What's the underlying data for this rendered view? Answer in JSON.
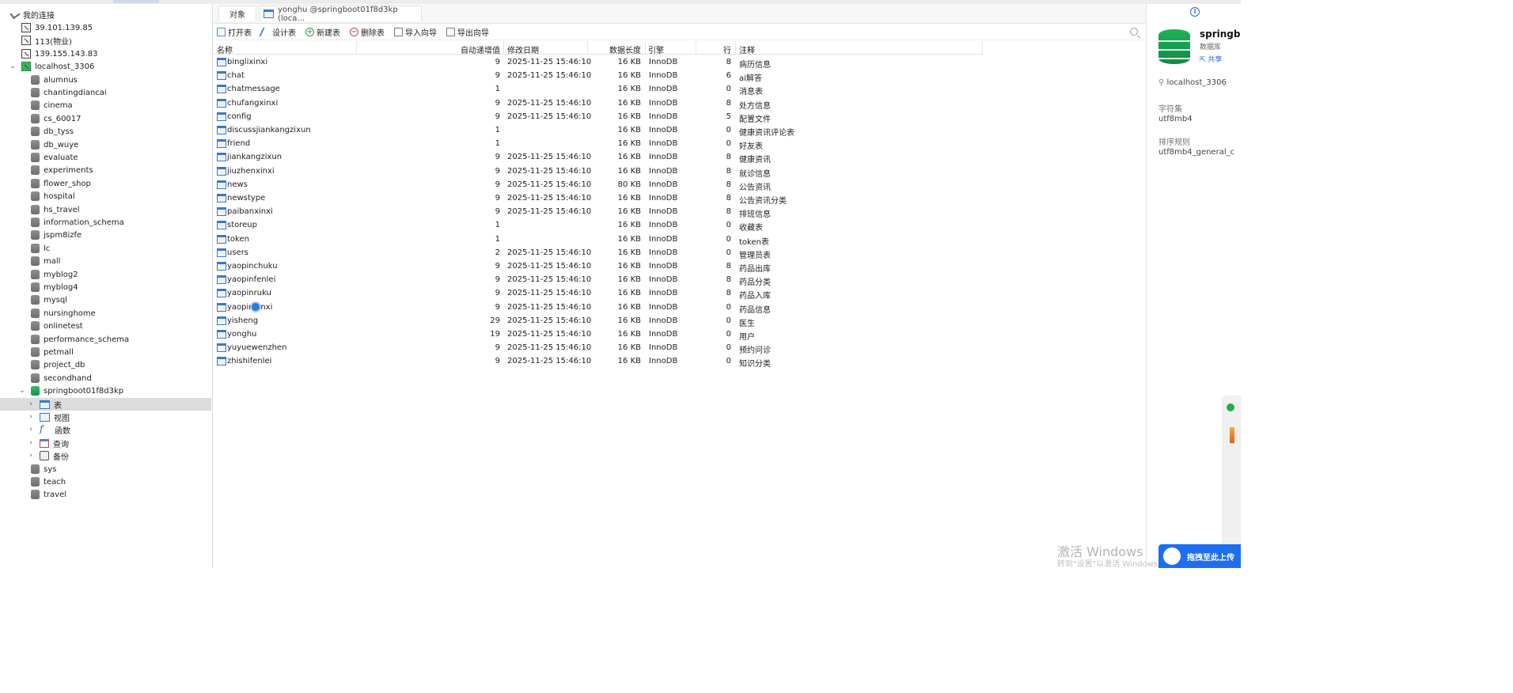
{
  "sidebar": {
    "root_label": "我的连接",
    "connections": [
      "39.101.139.85",
      "113(物业)",
      "139.155.143.83",
      "localhost_3306"
    ],
    "databases": [
      "alumnus",
      "chantingdiancai",
      "cinema",
      "cs_60017",
      "db_tyss",
      "db_wuye",
      "evaluate",
      "experiments",
      "flower_shop",
      "hospital",
      "hs_travel",
      "information_schema",
      "jspm8izfe",
      "lc",
      "mall",
      "myblog2",
      "myblog4",
      "mysql",
      "nursinghome",
      "onlinetest",
      "performance_schema",
      "petmall",
      "project_db",
      "secondhand",
      "springboot01f8d3kp"
    ],
    "sub_nodes": [
      "表",
      "视图",
      "函数",
      "查询",
      "备份"
    ],
    "databases_after": [
      "sys",
      "teach",
      "travel"
    ]
  },
  "tabs": {
    "objects": "对象",
    "table_tab": "yonghu @springboot01f8d3kp (loca..."
  },
  "toolbar": {
    "open": "打开表",
    "design": "设计表",
    "new": "新建表",
    "delete": "删除表",
    "import": "导入向导",
    "export": "导出向导"
  },
  "columns": {
    "name": "名称",
    "auto_inc": "自动递增值",
    "modified": "修改日期",
    "data_len": "数据长度",
    "engine": "引擎",
    "rows": "行",
    "comment": "注释"
  },
  "tables": [
    {
      "name": "binglixinxi",
      "auto": "9",
      "date": "2025-11-25 15:46:10",
      "size": "16 KB",
      "engine": "InnoDB",
      "rows": "8",
      "comment": "病历信息"
    },
    {
      "name": "chat",
      "auto": "9",
      "date": "2025-11-25 15:46:10",
      "size": "16 KB",
      "engine": "InnoDB",
      "rows": "6",
      "comment": "ai解答"
    },
    {
      "name": "chatmessage",
      "auto": "1",
      "date": "",
      "size": "16 KB",
      "engine": "InnoDB",
      "rows": "0",
      "comment": "消息表"
    },
    {
      "name": "chufangxinxi",
      "auto": "9",
      "date": "2025-11-25 15:46:10",
      "size": "16 KB",
      "engine": "InnoDB",
      "rows": "8",
      "comment": "处方信息"
    },
    {
      "name": "config",
      "auto": "9",
      "date": "2025-11-25 15:46:10",
      "size": "16 KB",
      "engine": "InnoDB",
      "rows": "5",
      "comment": "配置文件"
    },
    {
      "name": "discussjiankangzixun",
      "auto": "1",
      "date": "",
      "size": "16 KB",
      "engine": "InnoDB",
      "rows": "0",
      "comment": "健康资讯评论表"
    },
    {
      "name": "friend",
      "auto": "1",
      "date": "",
      "size": "16 KB",
      "engine": "InnoDB",
      "rows": "0",
      "comment": "好友表"
    },
    {
      "name": "jiankangzixun",
      "auto": "9",
      "date": "2025-11-25 15:46:10",
      "size": "16 KB",
      "engine": "InnoDB",
      "rows": "8",
      "comment": "健康资讯"
    },
    {
      "name": "jiuzhenxinxi",
      "auto": "9",
      "date": "2025-11-25 15:46:10",
      "size": "16 KB",
      "engine": "InnoDB",
      "rows": "8",
      "comment": "就诊信息"
    },
    {
      "name": "news",
      "auto": "9",
      "date": "2025-11-25 15:46:10",
      "size": "80 KB",
      "engine": "InnoDB",
      "rows": "8",
      "comment": "公告资讯"
    },
    {
      "name": "newstype",
      "auto": "9",
      "date": "2025-11-25 15:46:10",
      "size": "16 KB",
      "engine": "InnoDB",
      "rows": "8",
      "comment": "公告资讯分类"
    },
    {
      "name": "paibanxinxi",
      "auto": "9",
      "date": "2025-11-25 15:46:10",
      "size": "16 KB",
      "engine": "InnoDB",
      "rows": "8",
      "comment": "排班信息"
    },
    {
      "name": "storeup",
      "auto": "1",
      "date": "",
      "size": "16 KB",
      "engine": "InnoDB",
      "rows": "0",
      "comment": "收藏表"
    },
    {
      "name": "token",
      "auto": "1",
      "date": "",
      "size": "16 KB",
      "engine": "InnoDB",
      "rows": "0",
      "comment": "token表"
    },
    {
      "name": "users",
      "auto": "2",
      "date": "2025-11-25 15:46:10",
      "size": "16 KB",
      "engine": "InnoDB",
      "rows": "0",
      "comment": "管理员表"
    },
    {
      "name": "yaopinchuku",
      "auto": "9",
      "date": "2025-11-25 15:46:10",
      "size": "16 KB",
      "engine": "InnoDB",
      "rows": "8",
      "comment": "药品出库"
    },
    {
      "name": "yaopinfenlei",
      "auto": "9",
      "date": "2025-11-25 15:46:10",
      "size": "16 KB",
      "engine": "InnoDB",
      "rows": "8",
      "comment": "药品分类"
    },
    {
      "name": "yaopinruku",
      "auto": "9",
      "date": "2025-11-25 15:46:10",
      "size": "16 KB",
      "engine": "InnoDB",
      "rows": "8",
      "comment": "药品入库"
    },
    {
      "name": "yaopinxinxi",
      "auto": "9",
      "date": "2025-11-25 15:46:10",
      "size": "16 KB",
      "engine": "InnoDB",
      "rows": "0",
      "comment": "药品信息"
    },
    {
      "name": "yisheng",
      "auto": "29",
      "date": "2025-11-25 15:46:10",
      "size": "16 KB",
      "engine": "InnoDB",
      "rows": "0",
      "comment": "医生"
    },
    {
      "name": "yonghu",
      "auto": "19",
      "date": "2025-11-25 15:46:10",
      "size": "16 KB",
      "engine": "InnoDB",
      "rows": "0",
      "comment": "用户"
    },
    {
      "name": "yuyuewenzhen",
      "auto": "9",
      "date": "2025-11-25 15:46:10",
      "size": "16 KB",
      "engine": "InnoDB",
      "rows": "0",
      "comment": "预约问诊"
    },
    {
      "name": "zhishifenlei",
      "auto": "9",
      "date": "2025-11-25 15:46:10",
      "size": "16 KB",
      "engine": "InnoDB",
      "rows": "0",
      "comment": "知识分类"
    }
  ],
  "right_panel": {
    "title": "springb",
    "subtitle": "数据库",
    "share": "共享",
    "connection": "localhost_3306",
    "charset_label": "字符集",
    "charset_value": "utf8mb4",
    "collation_label": "排序规则",
    "collation_value": "utf8mb4_general_c"
  },
  "watermark": {
    "line1": "激活 Windows",
    "line2": "转到\"设置\"以激活 Windows。"
  },
  "upload_button": "拖拽至此上传",
  "colors": {
    "accent": "#1e6ef0",
    "db_active": "#1db35a",
    "table_icon": "#3a78c6"
  }
}
